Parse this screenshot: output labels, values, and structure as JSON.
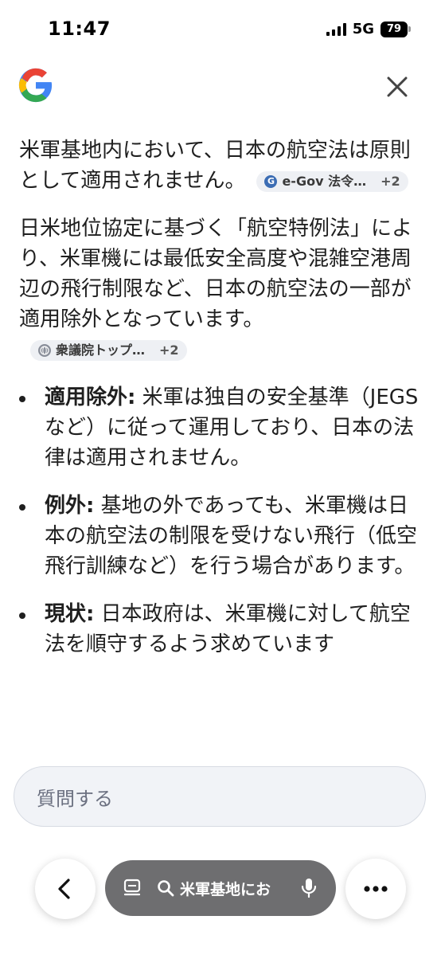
{
  "status_bar": {
    "time": "11:47",
    "network": "5G",
    "battery": "79"
  },
  "header": {
    "logo_icon": "google-g-logo",
    "close_icon": "close-icon"
  },
  "answer": {
    "para1_text": "米軍基地内において、日本の航空法は原則として適用されません。",
    "para1_chip": {
      "icon": "e-gov-icon",
      "icon_color": "#3c6db4",
      "label": "e-Gov 法令…",
      "count": "+2"
    },
    "para2_text": "日米地位協定に基づく「航空特例法」により、米軍機には最低安全高度や混雑空港周辺の飛行制限など、日本の航空法の一部が適用除外となっています。",
    "para2_chip": {
      "icon": "globe-icon",
      "icon_color": "#8a8f9a",
      "label": "衆議院トップ…",
      "count": "+2"
    },
    "bullets": [
      {
        "title": "適用除外:",
        "text": " 米軍は独自の安全基準（JEGSなど）に従って運用しており、日本の法律は適用されません。"
      },
      {
        "title": "例外:",
        "text": " 基地の外であっても、米軍機は日本の航空法の制限を受けない飛行（低空飛行訓練など）を行う場合があります。"
      },
      {
        "title": "現状:",
        "text": " 日本政府は、米軍機に対して航空法を順守するよう求めています"
      }
    ]
  },
  "ask_box": {
    "placeholder": "質問する"
  },
  "bottom_bar": {
    "back_icon": "chevron-left-icon",
    "tabs_icon": "tabs-icon",
    "search_icon": "search-icon",
    "query": "米軍基地にお",
    "mic_icon": "microphone-icon",
    "more_icon": "more-horizontal-icon"
  },
  "colors": {
    "google_blue": "#4285F4",
    "google_red": "#EA4335",
    "google_yellow": "#FBBC05",
    "google_green": "#34A853",
    "pill_bg": "#6e6e70"
  }
}
